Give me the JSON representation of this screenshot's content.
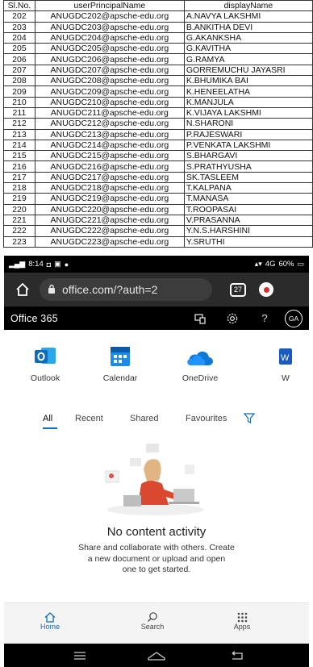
{
  "spreadsheet": {
    "headers": [
      "Sl.No.",
      "userPrincipalName",
      "displayName"
    ],
    "rows": [
      [
        "202",
        "ANUGDC202@apsche-edu.org",
        "A.NAVYA LAKSHMI"
      ],
      [
        "203",
        "ANUGDC203@apsche-edu.org",
        "B.ANKITHA DEVI"
      ],
      [
        "204",
        "ANUGDC204@apsche-edu.org",
        "G.AKANKSHA"
      ],
      [
        "205",
        "ANUGDC205@apsche-edu.org",
        "G.KAVITHA"
      ],
      [
        "206",
        "ANUGDC206@apsche-edu.org",
        "G.RAMYA"
      ],
      [
        "207",
        "ANUGDC207@apsche-edu.org",
        "GORREMUCHU JAYASRI"
      ],
      [
        "208",
        "ANUGDC208@apsche-edu.org",
        "K.BHUMIKA BAI"
      ],
      [
        "209",
        "ANUGDC209@apsche-edu.org",
        "K.HENEELATHA"
      ],
      [
        "210",
        "ANUGDC210@apsche-edu.org",
        "K.MANJULA"
      ],
      [
        "211",
        "ANUGDC211@apsche-edu.org",
        "K.VIJAYA LAKSHMI"
      ],
      [
        "212",
        "ANUGDC212@apsche-edu.org",
        "N.SHARONI"
      ],
      [
        "213",
        "ANUGDC213@apsche-edu.org",
        "P.RAJESWARI"
      ],
      [
        "214",
        "ANUGDC214@apsche-edu.org",
        "P.VENKATA LAKSHMI"
      ],
      [
        "215",
        "ANUGDC215@apsche-edu.org",
        "S.BHARGAVI"
      ],
      [
        "216",
        "ANUGDC216@apsche-edu.org",
        "S.PRATHYUSHA"
      ],
      [
        "217",
        "ANUGDC217@apsche-edu.org",
        "SK.TASLEEM"
      ],
      [
        "218",
        "ANUGDC218@apsche-edu.org",
        "T.KALPANA"
      ],
      [
        "219",
        "ANUGDC219@apsche-edu.org",
        "T.MANASA"
      ],
      [
        "220",
        "ANUGDC220@apsche-edu.org",
        "T.ROOPASAI"
      ],
      [
        "221",
        "ANUGDC221@apsche-edu.org",
        "V.PRASANNA"
      ],
      [
        "222",
        "ANUGDC222@apsche-edu.org",
        "Y.N.S.HARSHINI"
      ],
      [
        "223",
        "ANUGDC223@apsche-edu.org",
        "Y.SRUTHI"
      ]
    ]
  },
  "status_bar": {
    "time": "8:14",
    "signal": "4G",
    "battery": "60%"
  },
  "browser": {
    "url": "office.com/?auth=2",
    "tab_count": "27"
  },
  "app_header": {
    "title": "Office 365",
    "avatar_initials": "GA"
  },
  "apps": [
    {
      "label": "Outlook",
      "icon": "outlook-icon",
      "color": "#0f6cbd"
    },
    {
      "label": "Calendar",
      "icon": "calendar-icon",
      "color": "#1c8ce8"
    },
    {
      "label": "OneDrive",
      "icon": "onedrive-icon",
      "color": "#0f78d4"
    },
    {
      "label": "W",
      "icon": "word-icon",
      "color": "#185abd"
    }
  ],
  "filters": {
    "all": "All",
    "recent": "Recent",
    "shared": "Shared",
    "favourites": "Favourites"
  },
  "empty_state": {
    "title": "No content activity",
    "line1": "Share and collaborate with others. Create",
    "line2": "a new document or upload and open",
    "line3": "one to get started."
  },
  "bottom_nav": {
    "home": "Home",
    "search": "Search",
    "apps": "Apps"
  },
  "colors": {
    "accent": "#0f6cbd",
    "app_bar": "#000000",
    "url_bar": "#2b2b2b"
  }
}
